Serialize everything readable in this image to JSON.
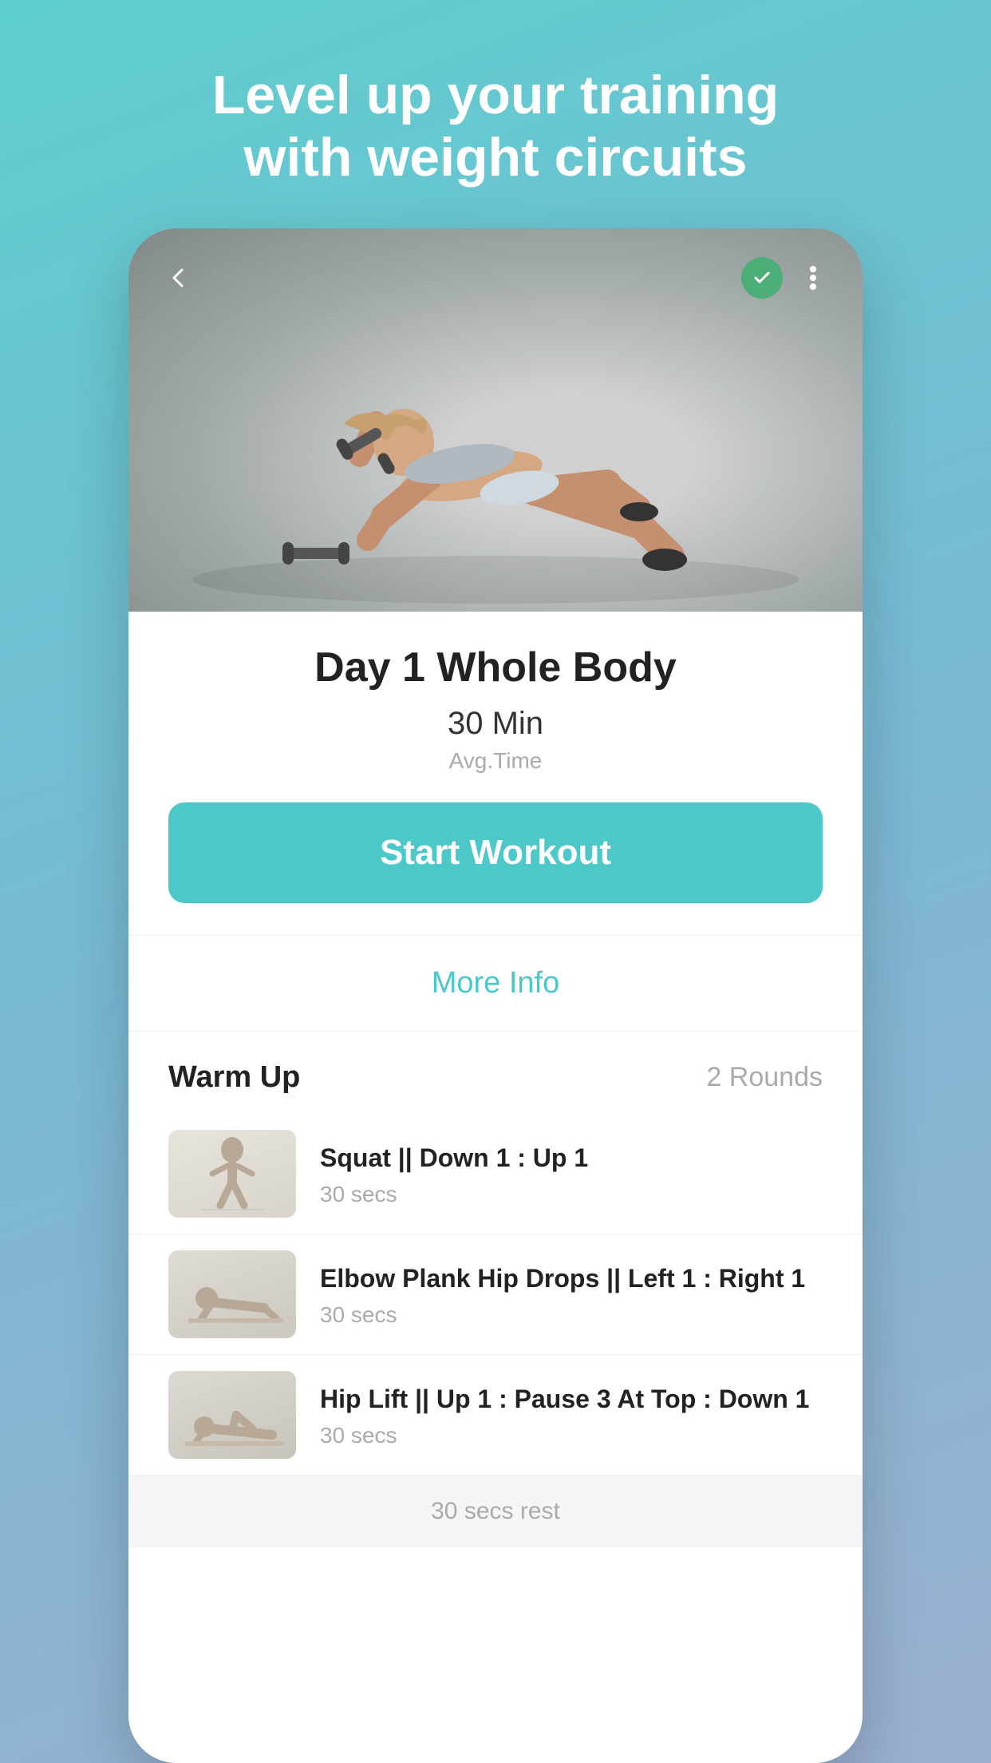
{
  "headline": {
    "line1": "Level up your training",
    "line2": "with weight circuits"
  },
  "hero": {
    "back_icon": "‹",
    "check_icon": "✓",
    "more_icon": "⋮"
  },
  "workout": {
    "title": "Day 1 Whole Body",
    "time_value": "30 Min",
    "time_label": "Avg.Time",
    "start_button": "Start Workout",
    "more_info": "More Info"
  },
  "warmup": {
    "section_title": "Warm Up",
    "rounds": "2 Rounds",
    "exercises": [
      {
        "name": "Squat || Down 1 : Up 1",
        "duration": "30 secs"
      },
      {
        "name": "Elbow Plank Hip Drops || Left 1 : Right 1",
        "duration": "30 secs"
      },
      {
        "name": "Hip Lift || Up 1 : Pause 3 At Top : Down 1",
        "duration": "30 secs"
      }
    ],
    "rest_label": "30 secs rest"
  }
}
